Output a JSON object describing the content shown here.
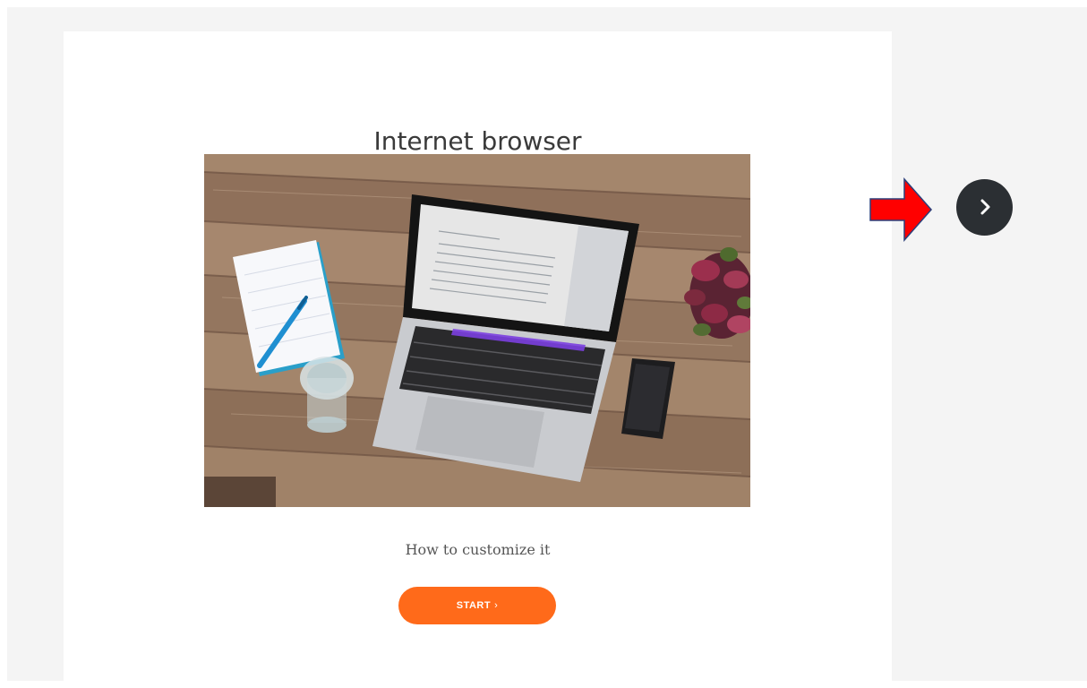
{
  "card": {
    "title": "Internet browser",
    "subtitle": "How to customize it",
    "start_label": "START",
    "start_chevron": "›"
  },
  "icons": {
    "next": "chevron-right-icon",
    "pointer": "red-arrow-icon",
    "photo": "desk-laptop-photo"
  },
  "colors": {
    "start_button": "#ff6a1a",
    "next_button": "#2b2f33",
    "pointer_arrow": "#ff0000",
    "background": "#f4f4f4",
    "card": "#ffffff"
  }
}
